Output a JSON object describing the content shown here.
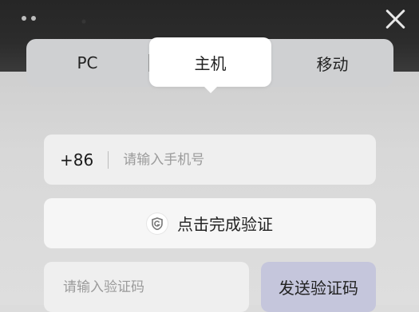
{
  "window": {
    "close_icon": "close-icon",
    "menu_dots_icon": "more-dots-icon"
  },
  "tabs": [
    {
      "label": "PC"
    },
    {
      "label": "主机"
    },
    {
      "label": "移动"
    }
  ],
  "active_tab": "主机",
  "phone": {
    "country_code": "+86",
    "placeholder": "请输入手机号",
    "value": ""
  },
  "captcha": {
    "label": "点击完成验证",
    "icon": "shield-icon"
  },
  "code": {
    "placeholder": "请输入验证码",
    "value": ""
  },
  "send_button": {
    "label": "发送验证码"
  },
  "colors": {
    "accent_button": "#c5c6dc",
    "field_bg": "#efefef",
    "tab_bar_bg": "#cfd0d2"
  }
}
